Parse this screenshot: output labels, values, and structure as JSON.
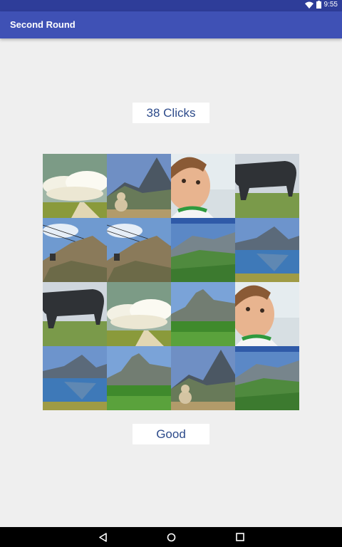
{
  "status_bar": {
    "time": "9:55"
  },
  "app_bar": {
    "title": "Second Round"
  },
  "game": {
    "clicks_label": "38 Clicks",
    "result_label": "Good",
    "tiles": [
      [
        "clouds-road",
        "mountain-teddy",
        "baby-face",
        "black-bull"
      ],
      [
        "cable-car",
        "cable-car",
        "green-valley",
        "mountain-lake"
      ],
      [
        "black-bull",
        "clouds-road",
        "peak-meadow",
        "baby-face"
      ],
      [
        "mountain-lake",
        "peak-meadow",
        "mountain-teddy",
        "green-valley"
      ]
    ]
  },
  "nav_bar": {
    "back_icon": "back-icon",
    "home_icon": "home-icon",
    "recents_icon": "recents-icon"
  }
}
